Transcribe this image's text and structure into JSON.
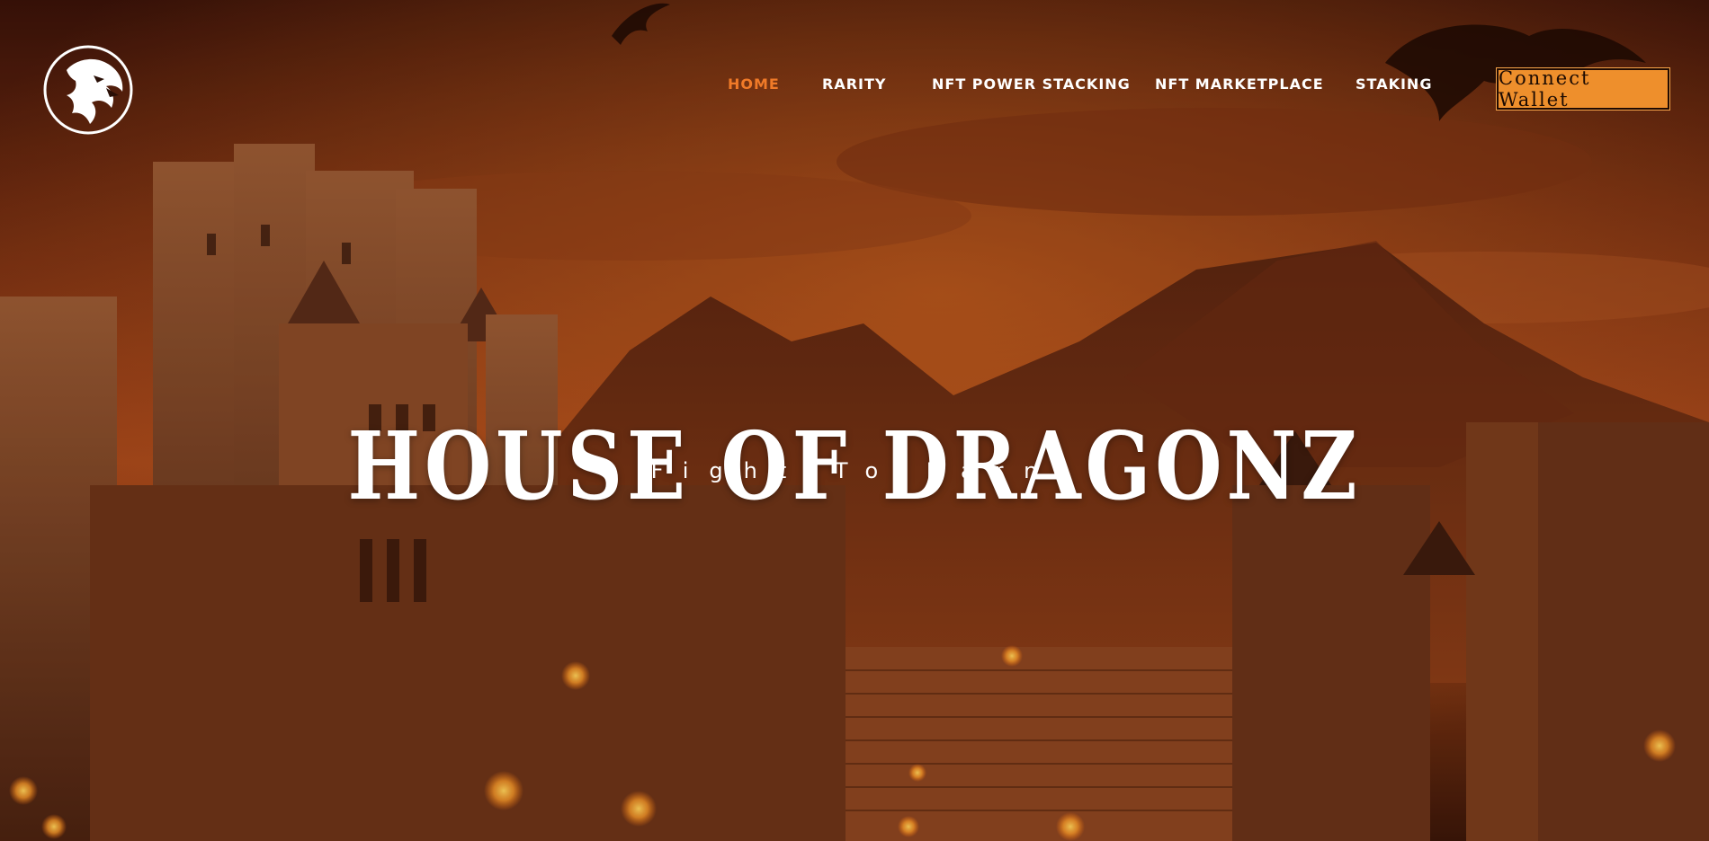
{
  "brand": {
    "logo_text": "House Of Dragonz",
    "icon": "dragon-head-icon"
  },
  "nav": {
    "items": [
      {
        "label": "HOME",
        "active": true
      },
      {
        "label": "RARITY",
        "active": false
      },
      {
        "label": "NFT POWER STACKING",
        "active": false
      },
      {
        "label": "NFT MARKETPLACE",
        "active": false
      },
      {
        "label": "STAKING",
        "active": false
      }
    ]
  },
  "actions": {
    "connect_wallet": "Connect Wallet"
  },
  "hero": {
    "title": "HOUSE OF DRAGONZ",
    "subtitle": "Fight To Earn"
  },
  "colors": {
    "accent": "#f07a28",
    "button": "#ee8f2c",
    "text": "#ffffff"
  }
}
